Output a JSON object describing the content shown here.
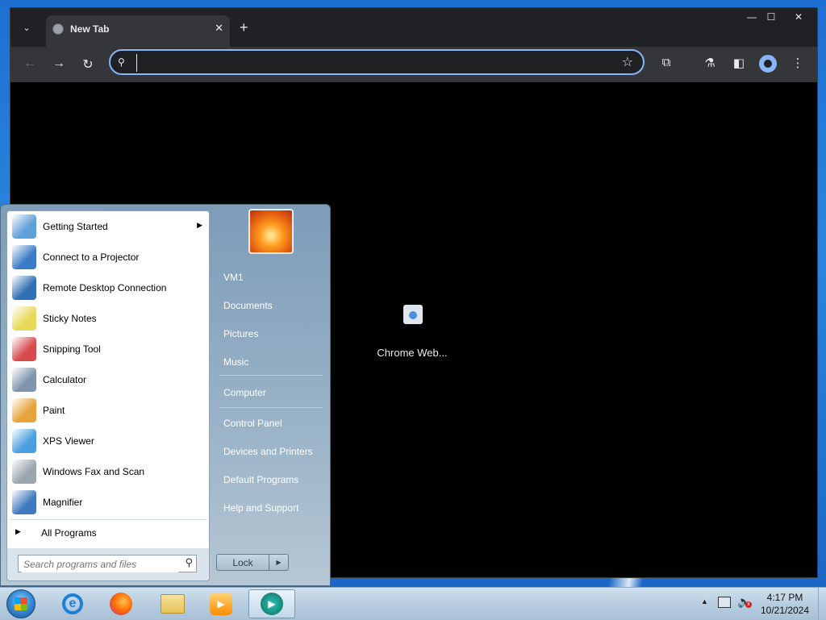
{
  "browser": {
    "tab": {
      "title": "New Tab",
      "close": "✕"
    },
    "new_tab": "+",
    "tab_menu": "⌄",
    "window": {
      "minimize": "—",
      "maximize": "☐",
      "close": "✕"
    },
    "nav": {
      "back": "←",
      "forward": "→",
      "reload": "↻"
    },
    "omnibox": {
      "value": "",
      "search_glyph": "⚲",
      "star": "☆"
    },
    "toolbar": {
      "extensions": "⧉",
      "labs": "⚗",
      "sidepanel": "◧",
      "menu": "⋮"
    },
    "content": {
      "shortcut_label": "Chrome Web..."
    }
  },
  "start_menu": {
    "programs": [
      {
        "label": "Getting Started",
        "icon": "getting-started-icon",
        "has_submenu": true,
        "color": "#5fa0d8"
      },
      {
        "label": "Connect to a Projector",
        "icon": "projector-icon",
        "has_submenu": false,
        "color": "#3a7bc8"
      },
      {
        "label": "Remote Desktop Connection",
        "icon": "remote-desktop-icon",
        "has_submenu": false,
        "color": "#2f6fb5"
      },
      {
        "label": "Sticky Notes",
        "icon": "sticky-notes-icon",
        "has_submenu": false,
        "color": "#e8d95a"
      },
      {
        "label": "Snipping Tool",
        "icon": "snipping-tool-icon",
        "has_submenu": false,
        "color": "#d64b4b"
      },
      {
        "label": "Calculator",
        "icon": "calculator-icon",
        "has_submenu": false,
        "color": "#7f95ad"
      },
      {
        "label": "Paint",
        "icon": "paint-icon",
        "has_submenu": false,
        "color": "#e7a43a"
      },
      {
        "label": "XPS Viewer",
        "icon": "xps-viewer-icon",
        "has_submenu": false,
        "color": "#4a9fe0"
      },
      {
        "label": "Windows Fax and Scan",
        "icon": "fax-scan-icon",
        "has_submenu": false,
        "color": "#9aa5b0"
      },
      {
        "label": "Magnifier",
        "icon": "magnifier-icon",
        "has_submenu": false,
        "color": "#3f79c0"
      }
    ],
    "all_programs": "All Programs",
    "all_programs_arrow": "▶",
    "submenu_arrow": "▶",
    "search": {
      "placeholder": "Search programs and files",
      "icon": "⚲"
    },
    "right_items": [
      {
        "label": "VM1"
      },
      {
        "label": "Documents"
      },
      {
        "label": "Pictures"
      },
      {
        "label": "Music"
      },
      {
        "label": "Computer"
      },
      {
        "label": "Control Panel"
      },
      {
        "label": "Devices and Printers"
      },
      {
        "label": "Default Programs"
      },
      {
        "label": "Help and Support"
      }
    ],
    "lock_button": "Lock",
    "lock_arrow": "▶"
  },
  "taskbar": {
    "apps": [
      {
        "name": "Internet Explorer",
        "icon": "internet-explorer-icon",
        "active": false
      },
      {
        "name": "Firefox",
        "icon": "firefox-icon",
        "active": false
      },
      {
        "name": "Windows Explorer",
        "icon": "folder-icon",
        "active": false
      },
      {
        "name": "Windows Media Player",
        "icon": "media-player-icon",
        "active": false
      },
      {
        "name": "Chrome",
        "icon": "chrome-icon",
        "active": true
      }
    ],
    "tray_up": "▲",
    "clock": {
      "time": "4:17 PM",
      "date": "10/21/2024"
    },
    "glyphs": {
      "ie": "e",
      "wmp": "▶",
      "chrome": "▶",
      "volume": "🔈",
      "volume_x": "x"
    }
  }
}
